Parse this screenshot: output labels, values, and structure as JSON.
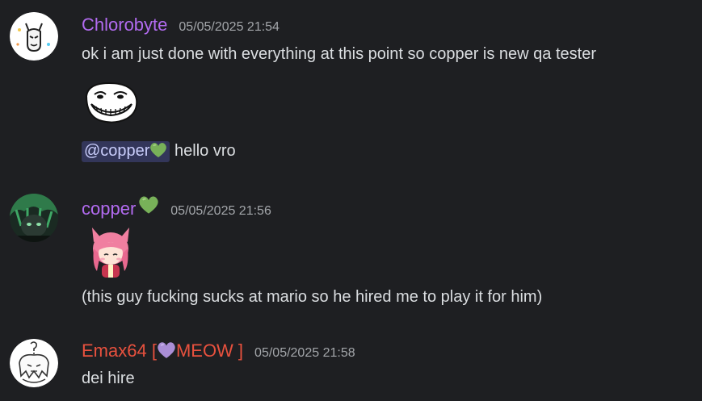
{
  "messages": [
    {
      "author": "Chlorobyte",
      "author_color": "#b26bf0",
      "timestamp": "05/05/2025 21:54",
      "line1": "ok i am just done with everything at this point so copper is new qa tester",
      "sticker": "trollface-emoji",
      "mention": "@copper",
      "mention_heart": "green-heart-emoji",
      "line2": " hello vro"
    },
    {
      "author": "copper",
      "author_color": "#b26bf0",
      "author_badge": "green-heart-emoji",
      "timestamp": "05/05/2025 21:56",
      "sticker": "anime-catgirl-emoji",
      "line1": "(this guy fucking sucks at mario so he hired me to play it for him)"
    },
    {
      "author": "Emax64 [",
      "author_tag": "MEOW ]",
      "author_tag_icon": "purple-heart-emoji",
      "author_color": "#e8513e",
      "timestamp": "05/05/2025 21:58",
      "line1": "dei hire"
    }
  ]
}
